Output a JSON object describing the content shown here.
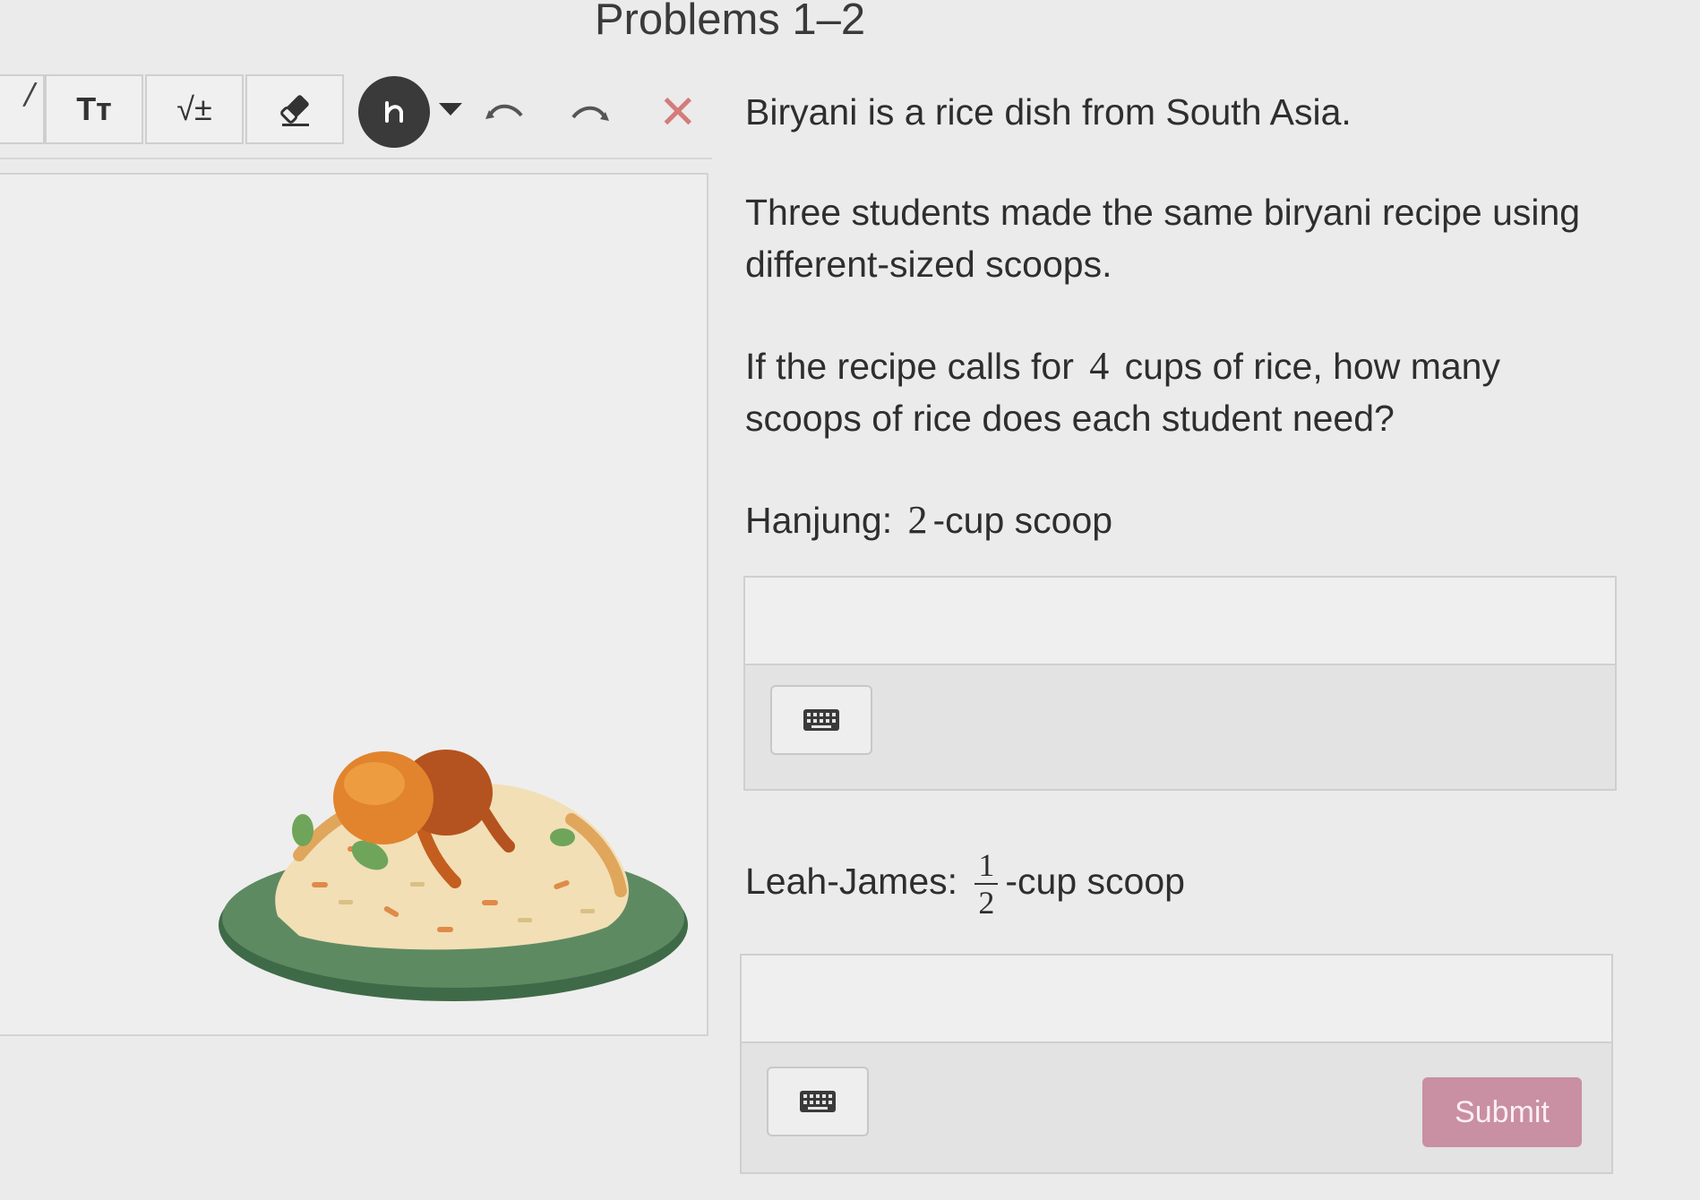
{
  "page": {
    "title": "Problems 1–2"
  },
  "toolbar": {
    "text_tool": "Tт",
    "math_tool": "√±",
    "tools": [
      "text-size-icon",
      "math-icon",
      "eraser-icon",
      "pen-icon",
      "chevron-down-icon",
      "undo-icon",
      "redo-icon",
      "close-icon"
    ],
    "pen_color": "#3a3a3a",
    "close_color": "#d47b7b"
  },
  "problem": {
    "intro": "Biryani is a rice dish from South Asia.",
    "context": "Three students made the same biryani recipe using different-sized scoops.",
    "question_before": "If the recipe calls for ",
    "question_number": "4",
    "question_after": " cups of rice, how many scoops of rice does each student need?",
    "students": [
      {
        "name": "Hanjung: ",
        "size": "2",
        "unit": "-cup scoop",
        "answer": ""
      },
      {
        "name": "Leah-James: ",
        "numerator": "1",
        "denominator": "2",
        "unit": "-cup scoop",
        "answer": ""
      }
    ]
  },
  "illustration": {
    "subject": "biryani-plate",
    "plate_color": "#5e8a62"
  },
  "submit": {
    "label": "Submit",
    "color": "#c98fa2"
  }
}
